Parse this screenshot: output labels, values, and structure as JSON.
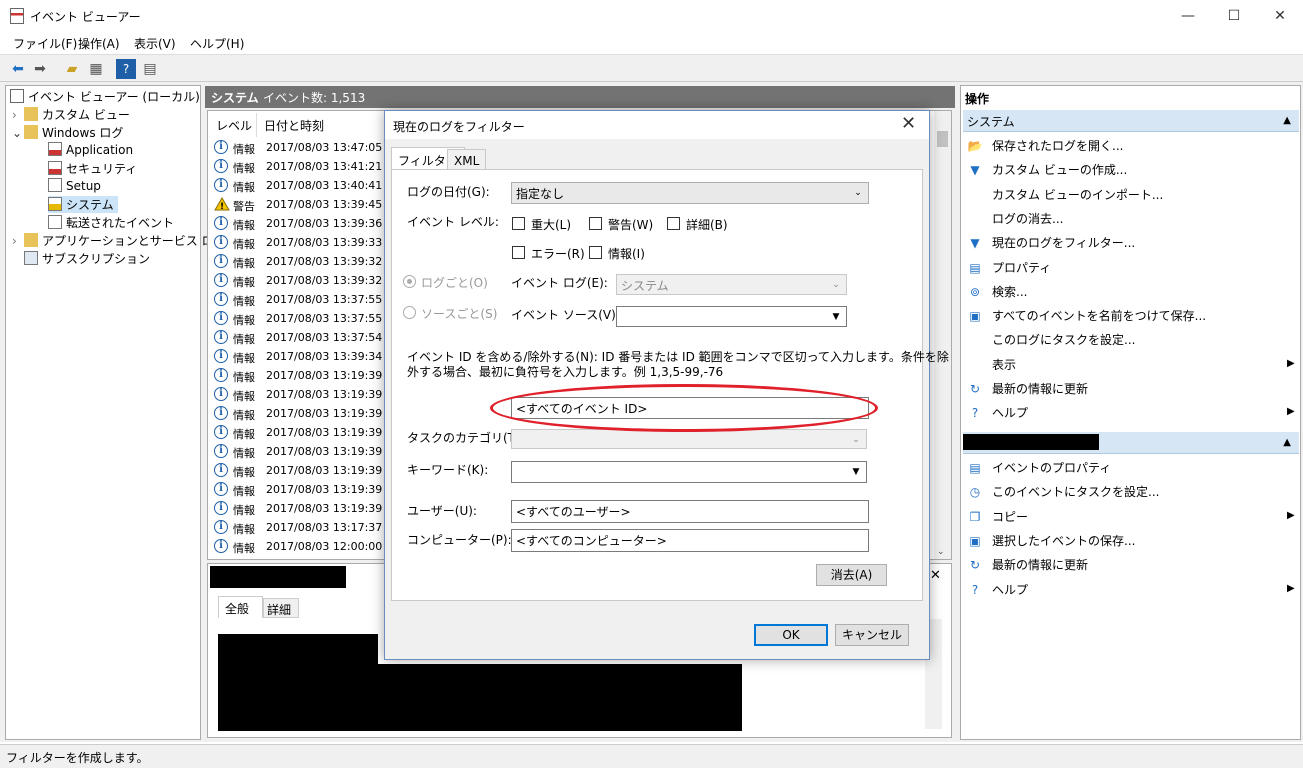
{
  "window": {
    "title": "イベント ビューアー",
    "minimize": "—",
    "maximize": "☐",
    "close": "✕"
  },
  "menu": [
    "ファイル(F)",
    "操作(A)",
    "表示(V)",
    "ヘルプ(H)"
  ],
  "toolbar": {
    "icons": [
      "back-icon",
      "forward-icon",
      "folder-up-icon",
      "console-tree-icon",
      "help-icon",
      "properties-icon"
    ]
  },
  "tree": {
    "root": "イベント ビューアー (ローカル)",
    "custom_views": "カスタム ビュー",
    "windows_logs": "Windows ログ",
    "logs": [
      "Application",
      "セキュリティ",
      "Setup",
      "システム",
      "転送されたイベント"
    ],
    "apps_services": "アプリケーションとサービス ログ",
    "subscriptions": "サブスクリプション"
  },
  "center": {
    "log_name": "システム",
    "event_count": "イベント数: 1,513",
    "columns": [
      "レベル",
      "日付と時刻"
    ],
    "rows": [
      {
        "level": "情報",
        "type": "info",
        "datetime": "2017/08/03 13:47:05"
      },
      {
        "level": "情報",
        "type": "info",
        "datetime": "2017/08/03 13:41:21"
      },
      {
        "level": "情報",
        "type": "info",
        "datetime": "2017/08/03 13:40:41"
      },
      {
        "level": "警告",
        "type": "warn",
        "datetime": "2017/08/03 13:39:45"
      },
      {
        "level": "情報",
        "type": "info",
        "datetime": "2017/08/03 13:39:36"
      },
      {
        "level": "情報",
        "type": "info",
        "datetime": "2017/08/03 13:39:33"
      },
      {
        "level": "情報",
        "type": "info",
        "datetime": "2017/08/03 13:39:32"
      },
      {
        "level": "情報",
        "type": "info",
        "datetime": "2017/08/03 13:39:32"
      },
      {
        "level": "情報",
        "type": "info",
        "datetime": "2017/08/03 13:37:55"
      },
      {
        "level": "情報",
        "type": "info",
        "datetime": "2017/08/03 13:37:55"
      },
      {
        "level": "情報",
        "type": "info",
        "datetime": "2017/08/03 13:37:54"
      },
      {
        "level": "情報",
        "type": "info",
        "datetime": "2017/08/03 13:39:34"
      },
      {
        "level": "情報",
        "type": "info",
        "datetime": "2017/08/03 13:19:39"
      },
      {
        "level": "情報",
        "type": "info",
        "datetime": "2017/08/03 13:19:39"
      },
      {
        "level": "情報",
        "type": "info",
        "datetime": "2017/08/03 13:19:39"
      },
      {
        "level": "情報",
        "type": "info",
        "datetime": "2017/08/03 13:19:39"
      },
      {
        "level": "情報",
        "type": "info",
        "datetime": "2017/08/03 13:19:39"
      },
      {
        "level": "情報",
        "type": "info",
        "datetime": "2017/08/03 13:19:39"
      },
      {
        "level": "情報",
        "type": "info",
        "datetime": "2017/08/03 13:19:39"
      },
      {
        "level": "情報",
        "type": "info",
        "datetime": "2017/08/03 13:19:39"
      },
      {
        "level": "情報",
        "type": "info",
        "datetime": "2017/08/03 13:17:37"
      },
      {
        "level": "情報",
        "type": "info",
        "datetime": "2017/08/03 12:00:00"
      }
    ]
  },
  "detail": {
    "tabs": [
      "全般",
      "詳細"
    ],
    "close": "✕"
  },
  "actions": {
    "header": "操作",
    "section1_title": "システム",
    "section1": [
      {
        "label": "保存されたログを開く...",
        "icon": "folder-open-icon",
        "glyph": "📂"
      },
      {
        "label": "カスタム ビューの作成...",
        "icon": "filter-icon",
        "glyph": "▼"
      },
      {
        "label": "カスタム ビューのインポート...",
        "icon": "",
        "glyph": ""
      },
      {
        "label": "ログの消去...",
        "icon": "",
        "glyph": ""
      },
      {
        "label": "現在のログをフィルター...",
        "icon": "filter-icon",
        "glyph": "▼"
      },
      {
        "label": "プロパティ",
        "icon": "properties-icon",
        "glyph": "▤"
      },
      {
        "label": "検索...",
        "icon": "binoculars-icon",
        "glyph": "⊚"
      },
      {
        "label": "すべてのイベントを名前をつけて保存...",
        "icon": "save-icon",
        "glyph": "▣"
      },
      {
        "label": "このログにタスクを設定...",
        "icon": "",
        "glyph": ""
      },
      {
        "label": "表示",
        "icon": "",
        "glyph": "",
        "submenu": true
      },
      {
        "label": "最新の情報に更新",
        "icon": "refresh-icon",
        "glyph": "↻"
      },
      {
        "label": "ヘルプ",
        "icon": "help-icon",
        "glyph": "?",
        "submenu": true
      }
    ],
    "section2": [
      {
        "label": "イベントのプロパティ",
        "icon": "properties-icon",
        "glyph": "▤"
      },
      {
        "label": "このイベントにタスクを設定...",
        "icon": "task-icon",
        "glyph": "◷"
      },
      {
        "label": "コピー",
        "icon": "copy-icon",
        "glyph": "❐",
        "submenu": true
      },
      {
        "label": "選択したイベントの保存...",
        "icon": "save-icon",
        "glyph": "▣"
      },
      {
        "label": "最新の情報に更新",
        "icon": "refresh-icon",
        "glyph": "↻"
      },
      {
        "label": "ヘルプ",
        "icon": "help-icon",
        "glyph": "?",
        "submenu": true
      }
    ]
  },
  "dialog": {
    "title": "現在のログをフィルター",
    "close": "✕",
    "tabs": [
      "フィルター",
      "XML"
    ],
    "logged_label": "ログの日付(G):",
    "logged_value": "指定なし",
    "level_label": "イベント レベル:",
    "levels": [
      "重大(L)",
      "警告(W)",
      "詳細(B)",
      "エラー(R)",
      "情報(I)"
    ],
    "by_log": "ログごと(O)",
    "by_source": "ソースごと(S)",
    "event_log_label": "イベント ログ(E):",
    "event_log_value": "システム",
    "event_source_label": "イベント ソース(V):",
    "id_desc_1": "イベント ID を含める/除外する(N): ID 番号または ID 範囲をコンマで区切って入力します。条件を除",
    "id_desc_2": "外する場合、最初に負符号を入力します。例 1,3,5-99,-76",
    "id_value": "<すべてのイベント ID>",
    "task_label": "タスクのカテゴリ(T):",
    "keyword_label": "キーワード(K):",
    "user_label": "ユーザー(U):",
    "user_value": "<すべてのユーザー>",
    "computer_label": "コンピューター(P):",
    "computer_value": "<すべてのコンピューター>",
    "clear": "消去(A)",
    "ok": "OK",
    "cancel": "キャンセル"
  },
  "status": "フィルターを作成します。"
}
